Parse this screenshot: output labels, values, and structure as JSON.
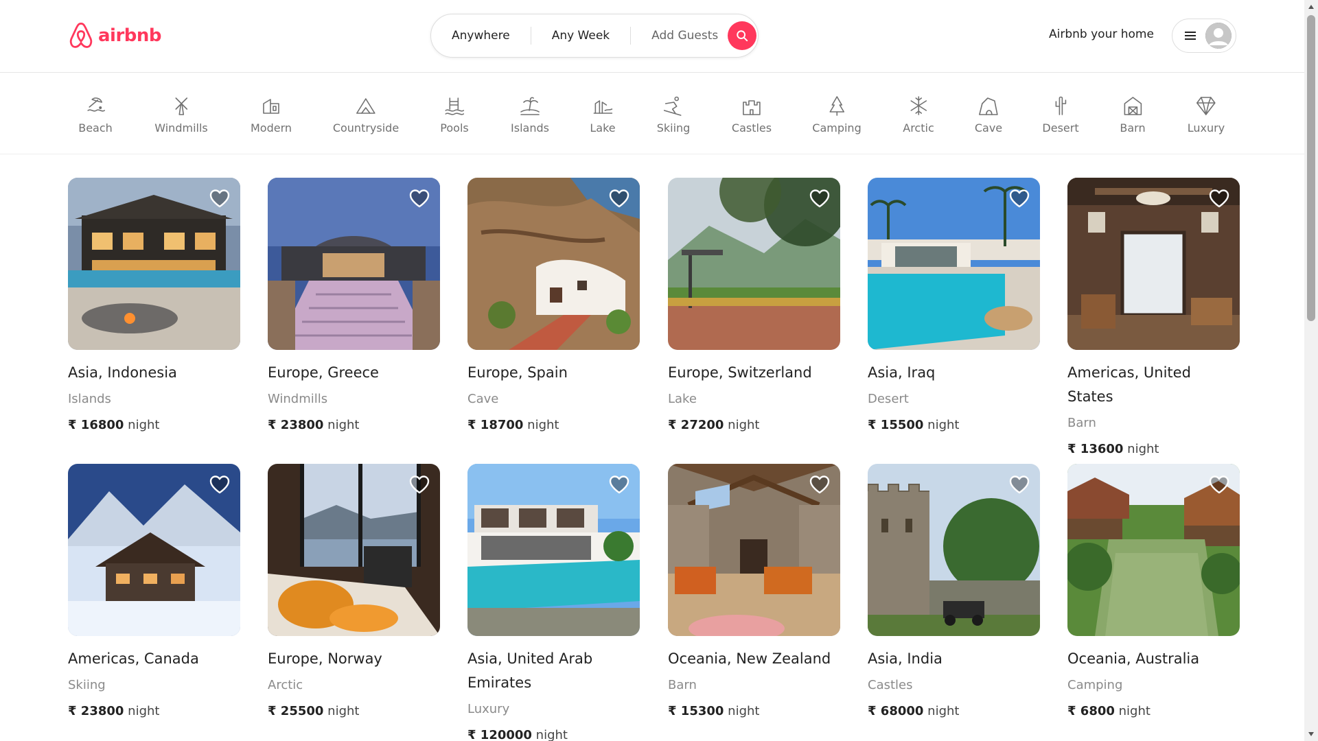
{
  "header": {
    "logo_text": "airbnb",
    "search": {
      "anywhere": "Anywhere",
      "week": "Any Week",
      "guests": "Add Guests"
    },
    "host_link": "Airbnb your home"
  },
  "colors": {
    "brand": "#ff385c",
    "muted": "#717171"
  },
  "categories": [
    {
      "label": "Beach",
      "icon": "beach-icon"
    },
    {
      "label": "Windmills",
      "icon": "windmill-icon"
    },
    {
      "label": "Modern",
      "icon": "modern-icon"
    },
    {
      "label": "Countryside",
      "icon": "countryside-icon"
    },
    {
      "label": "Pools",
      "icon": "pool-icon"
    },
    {
      "label": "Islands",
      "icon": "island-icon"
    },
    {
      "label": "Lake",
      "icon": "lake-icon"
    },
    {
      "label": "Skiing",
      "icon": "skiing-icon"
    },
    {
      "label": "Castles",
      "icon": "castle-icon"
    },
    {
      "label": "Camping",
      "icon": "camping-icon"
    },
    {
      "label": "Arctic",
      "icon": "arctic-icon"
    },
    {
      "label": "Cave",
      "icon": "cave-icon"
    },
    {
      "label": "Desert",
      "icon": "desert-icon"
    },
    {
      "label": "Barn",
      "icon": "barn-icon"
    },
    {
      "label": "Luxury",
      "icon": "luxury-icon"
    }
  ],
  "listings": [
    {
      "location": "Asia, Indonesia",
      "category": "Islands",
      "price": "₹ 16800",
      "per": "night"
    },
    {
      "location": "Europe, Greece",
      "category": "Windmills",
      "price": "₹ 23800",
      "per": "night"
    },
    {
      "location": "Europe, Spain",
      "category": "Cave",
      "price": "₹ 18700",
      "per": "night"
    },
    {
      "location": "Europe, Switzerland",
      "category": "Lake",
      "price": "₹ 27200",
      "per": "night"
    },
    {
      "location": "Asia, Iraq",
      "category": "Desert",
      "price": "₹ 15500",
      "per": "night"
    },
    {
      "location": "Americas, United States",
      "category": "Barn",
      "price": "₹ 13600",
      "per": "night"
    },
    {
      "location": "Americas, Canada",
      "category": "Skiing",
      "price": "₹ 23800",
      "per": "night"
    },
    {
      "location": "Europe, Norway",
      "category": "Arctic",
      "price": "₹ 25500",
      "per": "night"
    },
    {
      "location": "Asia, United Arab Emirates",
      "category": "Luxury",
      "price": "₹ 120000",
      "per": "night"
    },
    {
      "location": "Oceania, New Zealand",
      "category": "Barn",
      "price": "₹ 15300",
      "per": "night"
    },
    {
      "location": "Asia, India",
      "category": "Castles",
      "price": "₹ 68000",
      "per": "night"
    },
    {
      "location": "Oceania, Australia",
      "category": "Camping",
      "price": "₹ 6800",
      "per": "night"
    }
  ]
}
